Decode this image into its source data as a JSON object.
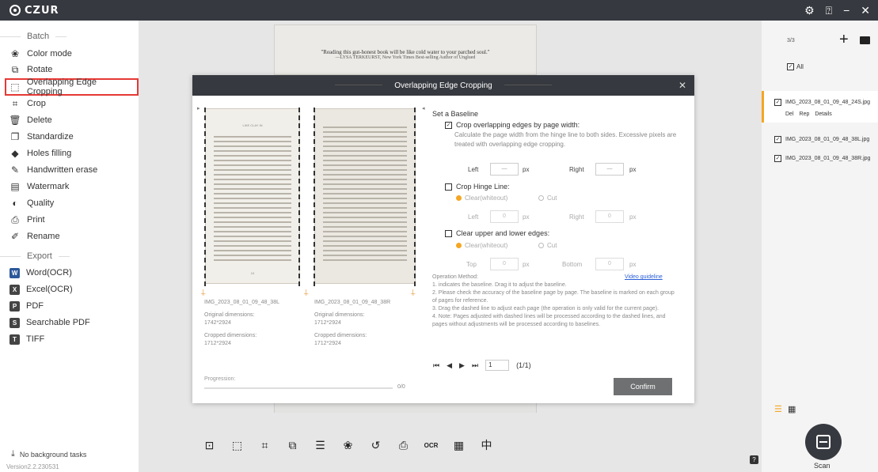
{
  "app": {
    "logo_text": "CZUR",
    "version": "Version2.2.230531"
  },
  "titlebar": {
    "settings_icon": "gear-icon",
    "help_icon": "question-icon",
    "minimize": "−",
    "close": "✕"
  },
  "sidebar": {
    "batch_header": "Batch",
    "batch_items": [
      {
        "label": "Color mode",
        "icon": "palette-icon"
      },
      {
        "label": "Rotate",
        "icon": "rotate-icon"
      },
      {
        "label": "Overlapping Edge Cropping",
        "icon": "crop-overlap-icon"
      },
      {
        "label": "Crop",
        "icon": "crop-icon"
      },
      {
        "label": "Delete",
        "icon": "trash-icon"
      },
      {
        "label": "Standardize",
        "icon": "standardize-icon"
      },
      {
        "label": "Holes filling",
        "icon": "fill-icon"
      },
      {
        "label": "Handwritten erase",
        "icon": "eraser-icon"
      },
      {
        "label": "Watermark",
        "icon": "watermark-icon"
      },
      {
        "label": "Quality",
        "icon": "quality-icon"
      },
      {
        "label": "Print",
        "icon": "printer-icon"
      },
      {
        "label": "Rename",
        "icon": "rename-icon"
      }
    ],
    "export_header": "Export",
    "export_items": [
      {
        "label": "Word(OCR)",
        "icon": "word-icon",
        "letter": "W",
        "color": "#2b579a"
      },
      {
        "label": "Excel(OCR)",
        "icon": "excel-icon",
        "letter": "X",
        "color": "#444444"
      },
      {
        "label": "PDF",
        "icon": "pdf-icon",
        "letter": "P",
        "color": "#444444"
      },
      {
        "label": "Searchable PDF",
        "icon": "searchable-pdf-icon",
        "letter": "S",
        "color": "#444444"
      },
      {
        "label": "TIFF",
        "icon": "tiff-icon",
        "letter": "T",
        "color": "#444444"
      }
    ],
    "no_tasks": "No background tasks"
  },
  "background_page": {
    "quote": "\"Reading this gut-honest book will be like cold water to your parched soul.\"",
    "attribution": "—LYSA TERKEURST, New York Times Best-selling Author of Unglued"
  },
  "modal": {
    "title": "Overlapping Edge Cropping",
    "close": "✕",
    "left_page": {
      "name": "IMG_2023_08_01_09_48_38L",
      "original_label": "Original dimensions:",
      "original_value": "1742*2924",
      "cropped_label": "Cropped dimensions:",
      "cropped_value": "1712*2924"
    },
    "right_page": {
      "name": "IMG_2023_08_01_09_48_38R",
      "original_label": "Original dimensions:",
      "original_value": "1712*2924",
      "cropped_label": "Cropped dimensions:",
      "cropped_value": "1712*2924"
    },
    "page_header": "LIKE CLAY IN",
    "page_number": "10",
    "progress_label": "Progression:",
    "progress_count": "0/0",
    "progress_fraction": 0,
    "settings": {
      "title": "Set a Baseline",
      "opt1_label": "Crop overlapping edges by page width:",
      "opt1_desc": "Calculate the page width from the hinge line to both sides. Excessive pixels are treated with overlapping edge cropping.",
      "left_label": "Left",
      "left_value": "—",
      "right_label": "Right",
      "right_value": "—",
      "px": "px",
      "opt2_label": "Crop Hinge Line:",
      "clear_label": "Clear(whiteout)",
      "cut_label": "Cut",
      "hinge_left_value": "0",
      "hinge_right_value": "0",
      "opt3_label": "Clear upper and lower edges:",
      "top_label": "Top",
      "top_value": "0",
      "bottom_label": "Bottom",
      "bottom_value": "0"
    },
    "method": {
      "title": "Operation Method:",
      "video_link": "Video guideline",
      "step1": "1. indicates the baseline. Drag it to adjust the baseline.",
      "step2": "2. Please check the accuracy of the baseline page by page. The baseline is marked on each group of pages for reference.",
      "step3": "3. Drag the dashed line to adjust each page (the operation is only valid for the current page).",
      "step4": "4. Note: Pages adjusted with dashed lines will be processed according to the dashed lines, and pages without adjustments will be processed according to baselines."
    },
    "pager": {
      "first": "⏮",
      "prev": "◀",
      "next": "▶",
      "last": "⏭",
      "page_value": "1",
      "total": "(1/1)"
    },
    "confirm": "Confirm"
  },
  "bottom_toolbar": [
    {
      "icon": "fit-icon",
      "glyph": "⊡"
    },
    {
      "icon": "select-icon",
      "glyph": "⬚"
    },
    {
      "icon": "crop-icon",
      "glyph": "⌗"
    },
    {
      "icon": "rotate-crop-icon",
      "glyph": "⧉"
    },
    {
      "icon": "standardize-icon",
      "glyph": "☰"
    },
    {
      "icon": "color-mode-icon",
      "glyph": "❀"
    },
    {
      "icon": "undo-icon",
      "glyph": "↺"
    },
    {
      "icon": "print-icon",
      "glyph": "⎙"
    },
    {
      "icon": "ocr-icon",
      "glyph": "OCR"
    },
    {
      "icon": "qr-icon",
      "glyph": "▦"
    },
    {
      "icon": "split-icon",
      "glyph": "中"
    }
  ],
  "right_panel": {
    "count": "3/3",
    "add": "+",
    "folder_icon": "folder-icon",
    "all_label": "All",
    "files": [
      {
        "name": "IMG_2023_08_01_09_48_24S.jpg",
        "checked": true
      },
      {
        "name": "IMG_2023_08_01_09_48_38L.jpg",
        "checked": true
      },
      {
        "name": "IMG_2023_08_01_09_48_38R.jpg",
        "checked": true
      }
    ],
    "file_actions": {
      "del": "Del",
      "rep": "Rep",
      "details": "Details"
    },
    "scan_label": "Scan",
    "accent": "#f5a623"
  }
}
